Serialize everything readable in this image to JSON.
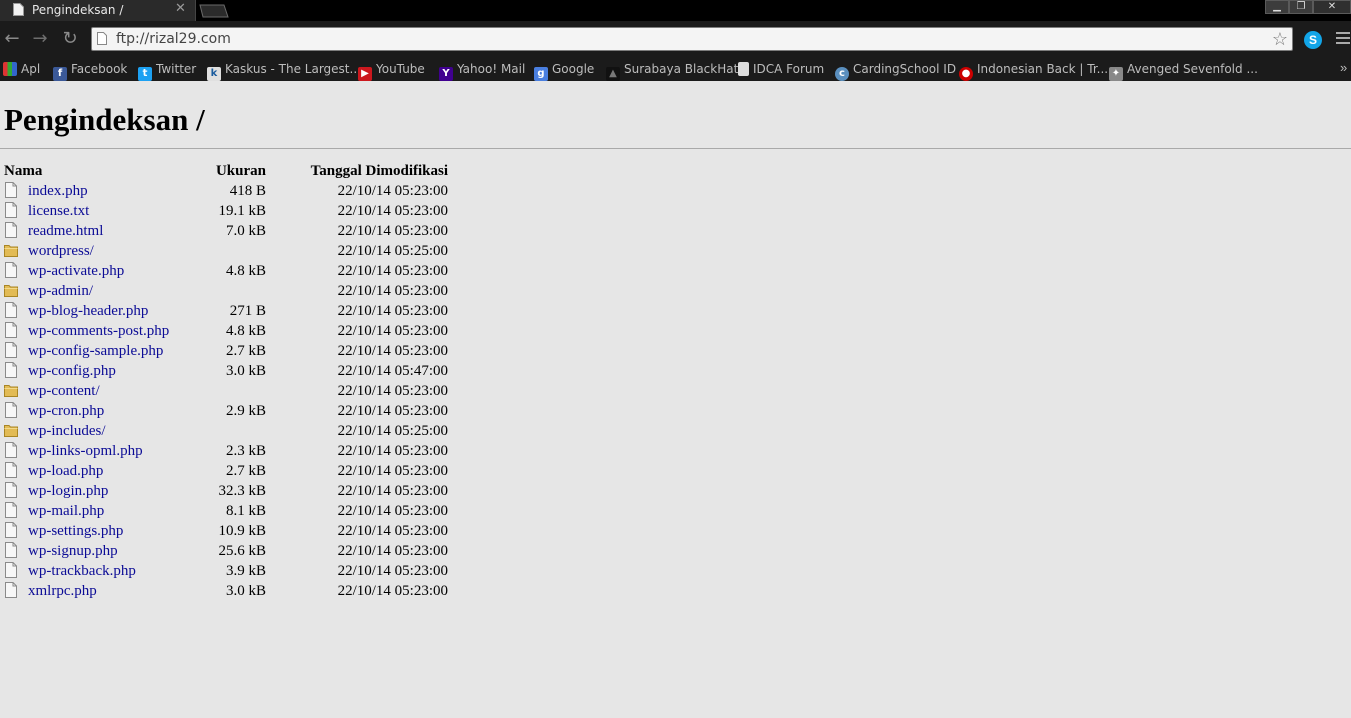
{
  "window": {
    "tab_title": "Pengindeksan /",
    "tab_close": "✕",
    "min": "▁",
    "max": "❐",
    "close": "✕"
  },
  "toolbar": {
    "back": "←",
    "forward": "→",
    "reload": "↻",
    "url": "ftp://rizal29.com",
    "star": "☆",
    "skype": "S"
  },
  "bookmarks": [
    {
      "label": "Apl",
      "icon": "apps-grid-icon",
      "color": "#d33"
    },
    {
      "label": "Facebook",
      "icon": "facebook-icon",
      "color": "#3b5998"
    },
    {
      "label": "Twitter",
      "icon": "twitter-icon",
      "color": "#1da1f2"
    },
    {
      "label": "Kaskus - The Largest...",
      "icon": "kaskus-icon",
      "color": "#e0e0e0"
    },
    {
      "label": "YouTube",
      "icon": "youtube-icon",
      "color": "#cc181e"
    },
    {
      "label": "Yahoo! Mail",
      "icon": "yahoo-icon",
      "color": "#400090"
    },
    {
      "label": "Google",
      "icon": "google-icon",
      "color": "#4a7fe0"
    },
    {
      "label": "Surabaya BlackHat",
      "icon": "blackhat-icon",
      "color": "#222"
    },
    {
      "label": "IDCA Forum",
      "icon": "page-icon",
      "color": "#ddd"
    },
    {
      "label": "CardingSchool ID",
      "icon": "cardingschool-icon",
      "color": "#5a8fbf"
    },
    {
      "label": "Indonesian Back | Tr...",
      "icon": "indonesian-back-icon",
      "color": "#c00"
    },
    {
      "label": "Avenged Sevenfold ...",
      "icon": "avenged-icon",
      "color": "#888"
    }
  ],
  "bookmarks_overflow": "»",
  "page": {
    "title": "Pengindeksan /",
    "headers": {
      "name": "Nama",
      "size": "Ukuran",
      "date": "Tanggal Dimodifikasi"
    },
    "rows": [
      {
        "name": "index.php",
        "size": "418 B",
        "date": "22/10/14 05:23:00",
        "type": "file"
      },
      {
        "name": "license.txt",
        "size": "19.1 kB",
        "date": "22/10/14 05:23:00",
        "type": "file"
      },
      {
        "name": "readme.html",
        "size": "7.0 kB",
        "date": "22/10/14 05:23:00",
        "type": "file"
      },
      {
        "name": "wordpress/",
        "size": "",
        "date": "22/10/14 05:25:00",
        "type": "folder"
      },
      {
        "name": "wp-activate.php",
        "size": "4.8 kB",
        "date": "22/10/14 05:23:00",
        "type": "file"
      },
      {
        "name": "wp-admin/",
        "size": "",
        "date": "22/10/14 05:23:00",
        "type": "folder"
      },
      {
        "name": "wp-blog-header.php",
        "size": "271 B",
        "date": "22/10/14 05:23:00",
        "type": "file"
      },
      {
        "name": "wp-comments-post.php",
        "size": "4.8 kB",
        "date": "22/10/14 05:23:00",
        "type": "file"
      },
      {
        "name": "wp-config-sample.php",
        "size": "2.7 kB",
        "date": "22/10/14 05:23:00",
        "type": "file"
      },
      {
        "name": "wp-config.php",
        "size": "3.0 kB",
        "date": "22/10/14 05:47:00",
        "type": "file"
      },
      {
        "name": "wp-content/",
        "size": "",
        "date": "22/10/14 05:23:00",
        "type": "folder"
      },
      {
        "name": "wp-cron.php",
        "size": "2.9 kB",
        "date": "22/10/14 05:23:00",
        "type": "file"
      },
      {
        "name": "wp-includes/",
        "size": "",
        "date": "22/10/14 05:25:00",
        "type": "folder"
      },
      {
        "name": "wp-links-opml.php",
        "size": "2.3 kB",
        "date": "22/10/14 05:23:00",
        "type": "file"
      },
      {
        "name": "wp-load.php",
        "size": "2.7 kB",
        "date": "22/10/14 05:23:00",
        "type": "file"
      },
      {
        "name": "wp-login.php",
        "size": "32.3 kB",
        "date": "22/10/14 05:23:00",
        "type": "file"
      },
      {
        "name": "wp-mail.php",
        "size": "8.1 kB",
        "date": "22/10/14 05:23:00",
        "type": "file"
      },
      {
        "name": "wp-settings.php",
        "size": "10.9 kB",
        "date": "22/10/14 05:23:00",
        "type": "file"
      },
      {
        "name": "wp-signup.php",
        "size": "25.6 kB",
        "date": "22/10/14 05:23:00",
        "type": "file"
      },
      {
        "name": "wp-trackback.php",
        "size": "3.9 kB",
        "date": "22/10/14 05:23:00",
        "type": "file"
      },
      {
        "name": "xmlrpc.php",
        "size": "3.0 kB",
        "date": "22/10/14 05:23:00",
        "type": "file"
      }
    ]
  }
}
